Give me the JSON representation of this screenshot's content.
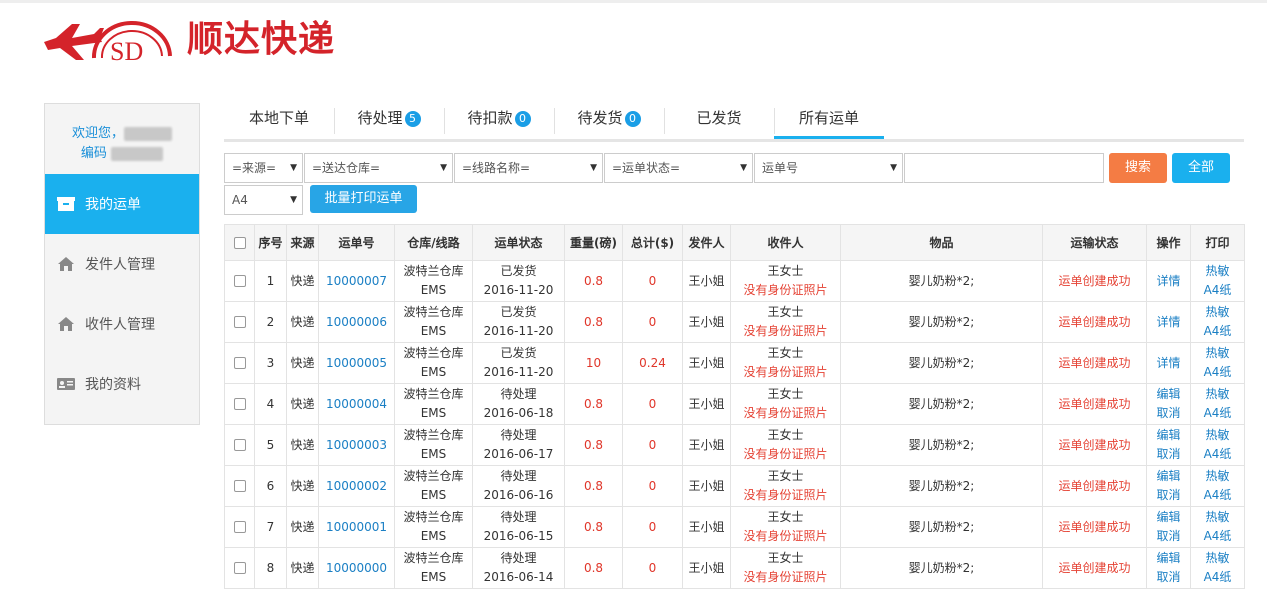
{
  "logo": {
    "mark": "SD",
    "brand": "顺达快递"
  },
  "colors": {
    "accent": "#1ab0ee",
    "brand": "#d4232a",
    "search": "#f47c44",
    "status_red": "#e0362a"
  },
  "sidebar": {
    "welcome": "欢迎您，",
    "code_label": "编码",
    "items": [
      {
        "label": "我的运单",
        "icon": "box-icon",
        "active": true
      },
      {
        "label": "发件人管理",
        "icon": "home-icon"
      },
      {
        "label": "收件人管理",
        "icon": "home-icon"
      },
      {
        "label": "我的资料",
        "icon": "id-card-icon"
      }
    ]
  },
  "tabs": [
    {
      "label": "本地下单"
    },
    {
      "label": "待处理",
      "badge": "5"
    },
    {
      "label": "待扣款",
      "badge": "0"
    },
    {
      "label": "待发货",
      "badge": "0"
    },
    {
      "label": "已发货"
    },
    {
      "label": "所有运单",
      "active": true
    }
  ],
  "filters": {
    "source": "=来源=",
    "warehouse": "=送达仓库=",
    "route": "=线路名称=",
    "status": "=运单状态=",
    "waybill_type": "运单号",
    "search_value": "",
    "search_btn": "搜索",
    "all_btn": "全部",
    "paper": "A4",
    "batch_print_btn": "批量打印运单"
  },
  "table": {
    "headers": [
      "",
      "序号",
      "来源",
      "运单号",
      "仓库/线路",
      "运单状态",
      "重量(磅)",
      "总计($)",
      "发件人",
      "收件人",
      "物品",
      "运输状态",
      "操作",
      "打印"
    ],
    "rows": [
      {
        "no": "1",
        "source": "快递",
        "waybill": "10000007",
        "wh": "波特兰仓库",
        "route": "EMS",
        "status": "已发货",
        "date": "2016-11-20",
        "weight": "0.8",
        "total": "0",
        "sender": "王小姐",
        "recv": "王女士",
        "recv_note": "没有身份证照片",
        "item": "婴儿奶粉*2;",
        "trans": "运单创建成功",
        "op1": "详情",
        "op2": "",
        "p1": "热敏",
        "p2": "A4纸"
      },
      {
        "no": "2",
        "source": "快递",
        "waybill": "10000006",
        "wh": "波特兰仓库",
        "route": "EMS",
        "status": "已发货",
        "date": "2016-11-20",
        "weight": "0.8",
        "total": "0",
        "sender": "王小姐",
        "recv": "王女士",
        "recv_note": "没有身份证照片",
        "item": "婴儿奶粉*2;",
        "trans": "运单创建成功",
        "op1": "详情",
        "op2": "",
        "p1": "热敏",
        "p2": "A4纸"
      },
      {
        "no": "3",
        "source": "快递",
        "waybill": "10000005",
        "wh": "波特兰仓库",
        "route": "EMS",
        "status": "已发货",
        "date": "2016-11-20",
        "weight": "10",
        "total": "0.24",
        "sender": "王小姐",
        "recv": "王女士",
        "recv_note": "没有身份证照片",
        "item": "婴儿奶粉*2;",
        "trans": "运单创建成功",
        "op1": "详情",
        "op2": "",
        "p1": "热敏",
        "p2": "A4纸"
      },
      {
        "no": "4",
        "source": "快递",
        "waybill": "10000004",
        "wh": "波特兰仓库",
        "route": "EMS",
        "status": "待处理",
        "date": "2016-06-18",
        "weight": "0.8",
        "total": "0",
        "sender": "王小姐",
        "recv": "王女士",
        "recv_note": "没有身份证照片",
        "item": "婴儿奶粉*2;",
        "trans": "运单创建成功",
        "op1": "编辑",
        "op2": "取消",
        "p1": "热敏",
        "p2": "A4纸"
      },
      {
        "no": "5",
        "source": "快递",
        "waybill": "10000003",
        "wh": "波特兰仓库",
        "route": "EMS",
        "status": "待处理",
        "date": "2016-06-17",
        "weight": "0.8",
        "total": "0",
        "sender": "王小姐",
        "recv": "王女士",
        "recv_note": "没有身份证照片",
        "item": "婴儿奶粉*2;",
        "trans": "运单创建成功",
        "op1": "编辑",
        "op2": "取消",
        "p1": "热敏",
        "p2": "A4纸"
      },
      {
        "no": "6",
        "source": "快递",
        "waybill": "10000002",
        "wh": "波特兰仓库",
        "route": "EMS",
        "status": "待处理",
        "date": "2016-06-16",
        "weight": "0.8",
        "total": "0",
        "sender": "王小姐",
        "recv": "王女士",
        "recv_note": "没有身份证照片",
        "item": "婴儿奶粉*2;",
        "trans": "运单创建成功",
        "op1": "编辑",
        "op2": "取消",
        "p1": "热敏",
        "p2": "A4纸"
      },
      {
        "no": "7",
        "source": "快递",
        "waybill": "10000001",
        "wh": "波特兰仓库",
        "route": "EMS",
        "status": "待处理",
        "date": "2016-06-15",
        "weight": "0.8",
        "total": "0",
        "sender": "王小姐",
        "recv": "王女士",
        "recv_note": "没有身份证照片",
        "item": "婴儿奶粉*2;",
        "trans": "运单创建成功",
        "op1": "编辑",
        "op2": "取消",
        "p1": "热敏",
        "p2": "A4纸"
      },
      {
        "no": "8",
        "source": "快递",
        "waybill": "10000000",
        "wh": "波特兰仓库",
        "route": "EMS",
        "status": "待处理",
        "date": "2016-06-14",
        "weight": "0.8",
        "total": "0",
        "sender": "王小姐",
        "recv": "王女士",
        "recv_note": "没有身份证照片",
        "item": "婴儿奶粉*2;",
        "trans": "运单创建成功",
        "op1": "编辑",
        "op2": "取消",
        "p1": "热敏",
        "p2": "A4纸"
      }
    ]
  }
}
